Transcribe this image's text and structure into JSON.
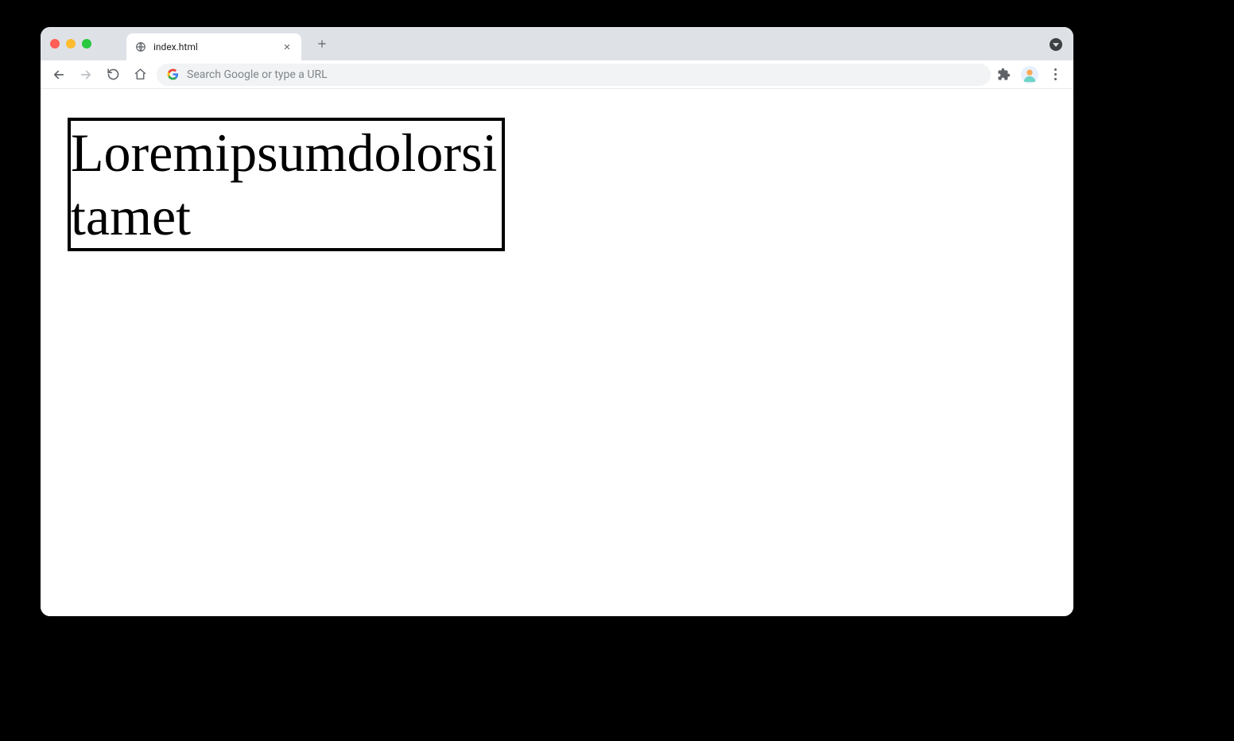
{
  "browser": {
    "tab": {
      "title": "index.html"
    },
    "omnibox": {
      "placeholder": "Search Google or type a URL"
    }
  },
  "page": {
    "box_text": "Loremipsumdolorsitamet"
  }
}
